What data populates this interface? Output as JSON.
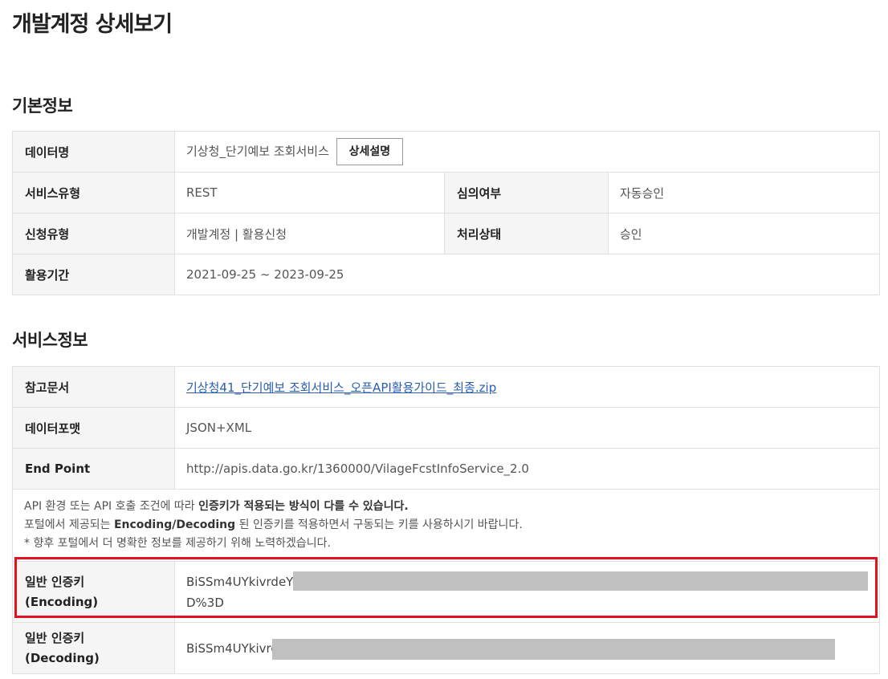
{
  "page": {
    "title": "개발계정 상세보기"
  },
  "basic": {
    "section_title": "기본정보",
    "data_name_label": "데이터명",
    "data_name_value": "기상청_단기예보 조회서비스",
    "detail_button": "상세설명",
    "service_type_label": "서비스유형",
    "service_type_value": "REST",
    "review_label": "심의여부",
    "review_value": "자동승인",
    "apply_type_label": "신청유형",
    "apply_type_value": "개발계정 | 활용신청",
    "status_label": "처리상태",
    "status_value": "승인",
    "period_label": "활용기간",
    "period_value": "2021-09-25 ~ 2023-09-25"
  },
  "service": {
    "section_title": "서비스정보",
    "ref_doc_label": "참고문서",
    "ref_doc_value": "기상청41_단기예보 조회서비스_오픈API활용가이드_최종.zip",
    "format_label": "데이터포맷",
    "format_value": "JSON+XML",
    "endpoint_label": "End Point",
    "endpoint_value": "http://apis.data.go.kr/1360000/VilageFcstInfoService_2.0",
    "notice": {
      "line1_pre": "API 환경 또는 API 호출 조건에 따라 ",
      "line1_bold": "인증키가 적용되는 방식이 다를 수 있습니다.",
      "line2_pre": "포털에서 제공되는 ",
      "line2_bold": "Encoding/Decoding",
      "line2_post": " 된 인증키를 적용하면서 구동되는 키를 사용하시기 바랍니다.",
      "line3": "* 향후 포털에서 더 명확한 정보를 제공하기 위해 노력하겠습니다."
    },
    "enc_label_1": "일반 인증키",
    "enc_label_2": "(Encoding)",
    "enc_key_start": "BiSSm4UYkivrdeYu",
    "enc_key_end": "D%3D",
    "dec_label_1": "일반 인증키",
    "dec_label_2": "(Decoding)",
    "dec_key_start": "BiSSm4UYkivrd"
  },
  "colors": {
    "highlight": "#e0141e",
    "redaction": "#c0c0c0",
    "link": "#2a5db0"
  }
}
